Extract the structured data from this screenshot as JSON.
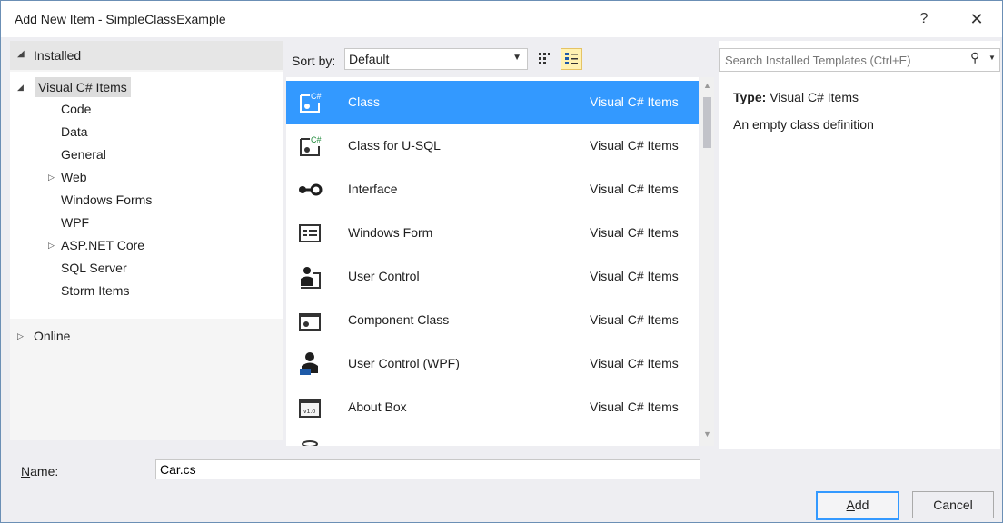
{
  "window": {
    "title": "Add New Item - SimpleClassExample",
    "help": "?",
    "close": "✕"
  },
  "left": {
    "header": "Installed",
    "root": "Visual C# Items",
    "children": [
      "Code",
      "Data",
      "General",
      "Web",
      "Windows Forms",
      "WPF",
      "ASP.NET Core",
      "SQL Server",
      "Storm Items"
    ],
    "online": "Online"
  },
  "toolbar": {
    "sort_label": "Sort by:",
    "sort_value": "Default"
  },
  "templates": [
    {
      "name": "Class",
      "category": "Visual C# Items",
      "icon": "class-icon"
    },
    {
      "name": "Class for U-SQL",
      "category": "Visual C# Items",
      "icon": "class-usql-icon"
    },
    {
      "name": "Interface",
      "category": "Visual C# Items",
      "icon": "interface-icon"
    },
    {
      "name": "Windows Form",
      "category": "Visual C# Items",
      "icon": "windows-form-icon"
    },
    {
      "name": "User Control",
      "category": "Visual C# Items",
      "icon": "user-control-icon"
    },
    {
      "name": "Component Class",
      "category": "Visual C# Items",
      "icon": "component-class-icon"
    },
    {
      "name": "User Control (WPF)",
      "category": "Visual C# Items",
      "icon": "user-control-wpf-icon"
    },
    {
      "name": "About Box",
      "category": "Visual C# Items",
      "icon": "about-box-icon"
    }
  ],
  "search": {
    "placeholder": "Search Installed Templates (Ctrl+E)"
  },
  "details": {
    "type_label": "Type:",
    "type_value": "Visual C# Items",
    "description": "An empty class definition"
  },
  "name_field": {
    "label_prefix": "N",
    "label_rest": "ame:",
    "value": "Car.cs"
  },
  "buttons": {
    "add_prefix": "A",
    "add_rest": "dd",
    "cancel": "Cancel"
  },
  "colors": {
    "selection": "#3399ff",
    "accent_border": "#6b8fb5"
  }
}
